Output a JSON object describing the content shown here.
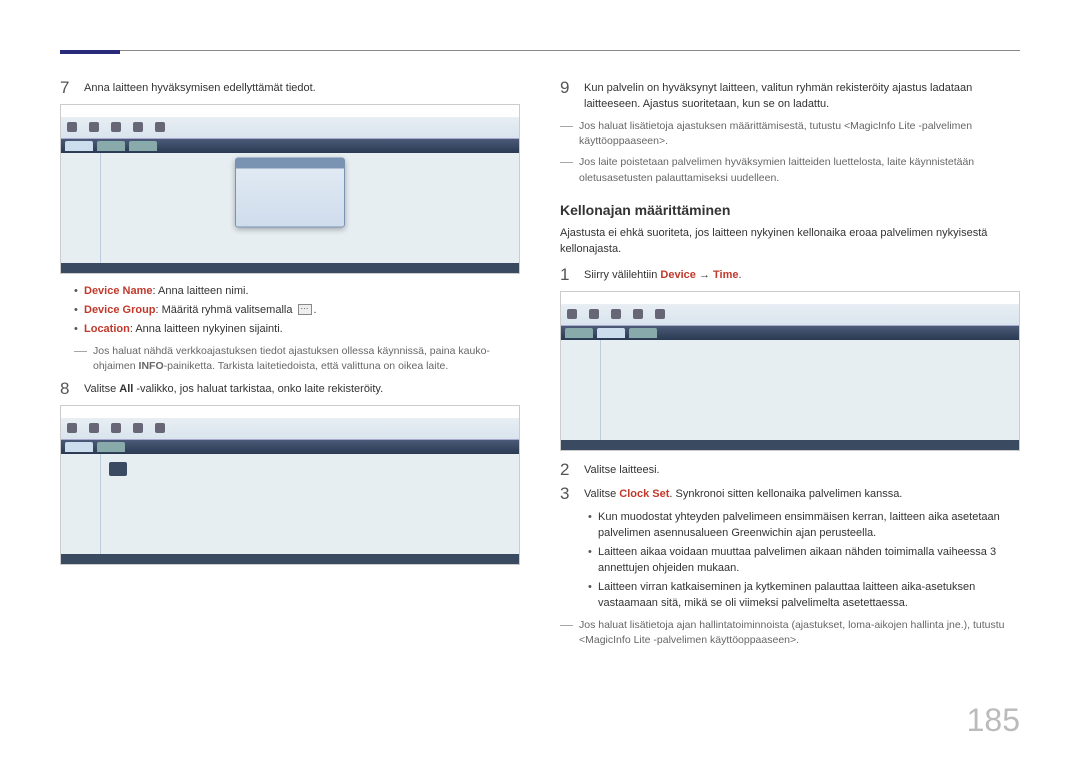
{
  "page_number": "185",
  "section2_title": "Kellonajan määrittäminen",
  "left": {
    "step7": {
      "text": "Anna laitteen hyväksymisen edellyttämät tiedot."
    },
    "bullets": {
      "b1_label": "Device Name",
      "b1_text": ": Anna laitteen nimi.",
      "b2_label": "Device Group",
      "b2_text_a": ": Määritä ryhmä valitsemalla ",
      "b2_text_b": ".",
      "b3_label": "Location",
      "b3_text": ": Anna laitteen nykyinen sijainti."
    },
    "note1_a": "Jos haluat nähdä verkkoajastuksen tiedot ajastuksen ollessa käynnissä, paina kauko-ohjaimen ",
    "note1_bold": "INFO",
    "note1_b": "-painiketta. Tarkista laitetiedoista, että valittuna on oikea laite.",
    "step8_a": "Valitse ",
    "step8_bold": "All",
    "step8_b": " -valikko, jos haluat tarkistaa, onko laite rekisteröity."
  },
  "right": {
    "step9": "Kun palvelin on hyväksynyt laitteen, valitun ryhmän rekisteröity ajastus ladataan laitteeseen. Ajastus suoritetaan, kun se on ladattu.",
    "note_r1": "Jos haluat lisätietoja ajastuksen määrittämisestä, tutustu <MagicInfo Lite -palvelimen käyttöoppaaseen>.",
    "note_r2": "Jos laite poistetaan palvelimen hyväksymien laitteiden luettelosta, laite käynnistetään oletusasetusten palauttamiseksi uudelleen.",
    "section2_intro": "Ajastusta ei ehkä suoriteta, jos laitteen nykyinen kellonaika eroaa palvelimen nykyisestä kellonajasta.",
    "step1_a": "Siirry välilehtiin ",
    "step1_red1": "Device",
    "step1_arrow": " → ",
    "step1_red2": "Time",
    "step1_b": ".",
    "step2": "Valitse laitteesi.",
    "step3_a": "Valitse ",
    "step3_red": "Clock Set",
    "step3_b": ". Synkronoi sitten kellonaika palvelimen kanssa.",
    "sub_bullets": {
      "s1": "Kun muodostat yhteyden palvelimeen ensimmäisen kerran, laitteen aika asetetaan palvelimen asennusalueen Greenwichin ajan perusteella.",
      "s2": "Laitteen aikaa voidaan muuttaa palvelimen aikaan nähden toimimalla vaiheessa 3 annettujen ohjeiden mukaan.",
      "s3": "Laitteen virran katkaiseminen ja kytkeminen palauttaa laitteen aika-asetuksen vastaamaan sitä, mikä se oli viimeksi palvelimelta asetettaessa."
    },
    "note_r3": "Jos haluat lisätietoja ajan hallintatoiminnoista (ajastukset, loma-aikojen hallinta jne.), tutustu <MagicInfo Lite -palvelimen käyttöoppaaseen>."
  }
}
